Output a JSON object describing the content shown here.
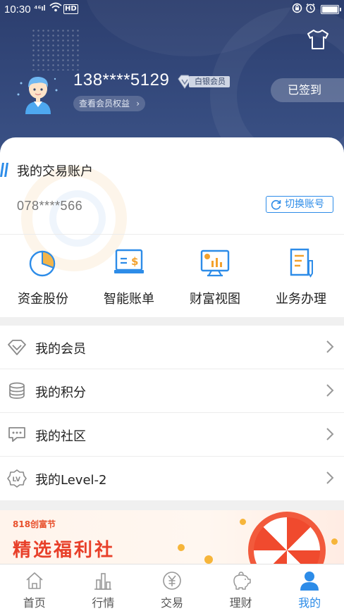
{
  "status_bar": {
    "time": "10:30",
    "signal_label": "⁴⁶ıl",
    "hd_label": "HD"
  },
  "profile": {
    "phone": "138****5129",
    "member_level": "白银会员",
    "benefits_link": "查看会员权益",
    "checkin_label": "已签到"
  },
  "account": {
    "title": "我的交易账户",
    "number": "078****566",
    "switch_label": "切换账号"
  },
  "quick_actions": [
    {
      "label": "资金股份",
      "icon": "pie-chart-icon"
    },
    {
      "label": "智能账单",
      "icon": "bill-icon"
    },
    {
      "label": "财富视图",
      "icon": "wealth-chart-icon"
    },
    {
      "label": "业务办理",
      "icon": "document-pen-icon"
    }
  ],
  "menu": [
    {
      "label": "我的会员",
      "icon": "diamond-icon"
    },
    {
      "label": "我的积分",
      "icon": "coins-icon"
    },
    {
      "label": "我的社区",
      "icon": "chat-icon"
    },
    {
      "label": "我的Level-2",
      "icon": "lv-badge-icon"
    }
  ],
  "banner": {
    "tag": "818创富节",
    "title": "精选福利社"
  },
  "bottom_nav": [
    {
      "label": "首页",
      "icon": "home-icon",
      "active": false
    },
    {
      "label": "行情",
      "icon": "bars-icon",
      "active": false
    },
    {
      "label": "交易",
      "icon": "yuan-icon",
      "active": false
    },
    {
      "label": "理财",
      "icon": "piggy-bank-icon",
      "active": false
    },
    {
      "label": "我的",
      "icon": "person-icon",
      "active": true
    }
  ],
  "colors": {
    "header_navy": "#34497c",
    "accent_blue": "#2d8ce8",
    "banner_red": "#e8402a"
  }
}
